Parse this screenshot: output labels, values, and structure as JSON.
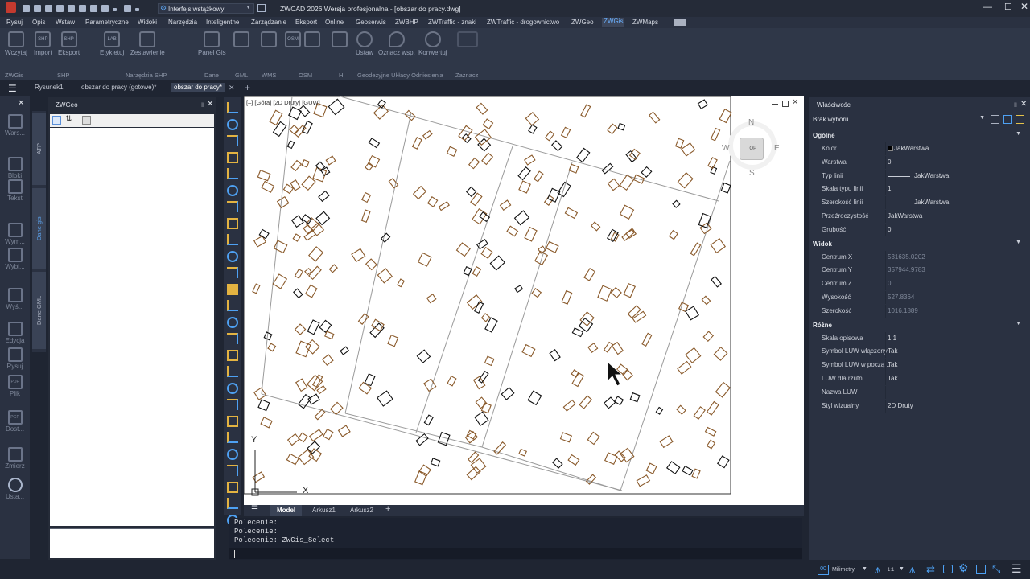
{
  "title": "ZWCAD 2026 Wersja profesjonalna - [obszar do pracy.dwg]",
  "workspace": "Interfejs wstążkowy",
  "menu": [
    "Rysuj",
    "Opis",
    "Wstaw",
    "Parametryczne",
    "Widoki",
    "Narzędzia",
    "Inteligentne",
    "Zarządzanie",
    "Eksport",
    "Online",
    "Geoserwis",
    "ZWBHP",
    "ZWTraffic - znaki",
    "ZWTraffic - drogownictwo",
    "ZWGeo",
    "ZWGis",
    "ZWMaps"
  ],
  "active_menu": "ZWGis",
  "ribbon": {
    "buttons": [
      "Wczytaj",
      "Import",
      "Eksport",
      "Etykietuj",
      "Zestawienie",
      "Panel Gis",
      "Ustaw",
      "Oznacz wsp.",
      "Konwertuj"
    ],
    "groups": [
      "ZWGis",
      "SHP",
      "Narzędzia SHP",
      "Dane",
      "GML",
      "WMS",
      "OSM",
      "H",
      "Geodezyjne Układy Odniesienia",
      "Zaznacz"
    ],
    "icon_labels": [
      "SHP",
      "SHP",
      "LAB",
      "OSM"
    ]
  },
  "doc_tabs": [
    "Rysunek1",
    "obszar do pracy (gotowe)*",
    "obszar do pracy*"
  ],
  "left_tools": [
    "Wars...",
    "Bloki",
    "Tekst",
    "Wym...",
    "Wybi...",
    "Wyś...",
    "Edycja",
    "Rysuj",
    "Plik",
    "Dost...",
    "Zmierz",
    "Usta..."
  ],
  "left_tools_icon_labels": [
    "PDF",
    "PGP"
  ],
  "vertical_tabs": [
    "ATP",
    "Dane gis",
    "Dane GML"
  ],
  "zwgeo_panel": {
    "title": "ZWGeo"
  },
  "viewport": {
    "label": "[–] [Góra] [2D Druty] [GUW]",
    "compass": {
      "n": "N",
      "s": "S",
      "e": "E",
      "w": "W",
      "top": "TOP"
    },
    "ucs": {
      "x": "X",
      "y": "Y"
    }
  },
  "layout_tabs": [
    "Model",
    "Arkusz1",
    "Arkusz2"
  ],
  "command_lines": [
    "Polecenie:",
    "Polecenie:",
    "Polecenie: ZWGis_Select"
  ],
  "properties": {
    "title": "Właściwości",
    "selection": "Brak wyboru",
    "sections": [
      {
        "name": "Ogólne",
        "rows": [
          [
            "Kolor",
            "JakWarstwa"
          ],
          [
            "Warstwa",
            "0"
          ],
          [
            "Typ linii",
            "JakWarstwa"
          ],
          [
            "Skala typu linii",
            "1"
          ],
          [
            "Szerokość linii",
            "JakWarstwa"
          ],
          [
            "Przeźroczystość",
            "JakWarstwa"
          ],
          [
            "Grubość",
            "0"
          ]
        ]
      },
      {
        "name": "Widok",
        "rows": [
          [
            "Centrum X",
            "531635.0202"
          ],
          [
            "Centrum Y",
            "357944.9783"
          ],
          [
            "Centrum Z",
            "0"
          ],
          [
            "Wysokość",
            "527.8364"
          ],
          [
            "Szerokość",
            "1016.1889"
          ]
        ]
      },
      {
        "name": "Różne",
        "rows": [
          [
            "Skala opisowa",
            "1:1"
          ],
          [
            "Symbol LUW włączony",
            "Tak"
          ],
          [
            "Symbol LUW w począ...",
            "Tak"
          ],
          [
            "LUW dla rzutni",
            "Tak"
          ],
          [
            "Nazwa LUW",
            ""
          ],
          [
            "Styl wizualny",
            "2D Druty"
          ]
        ]
      }
    ]
  },
  "status": {
    "units": "Milimetry",
    "scale": "1:1"
  }
}
